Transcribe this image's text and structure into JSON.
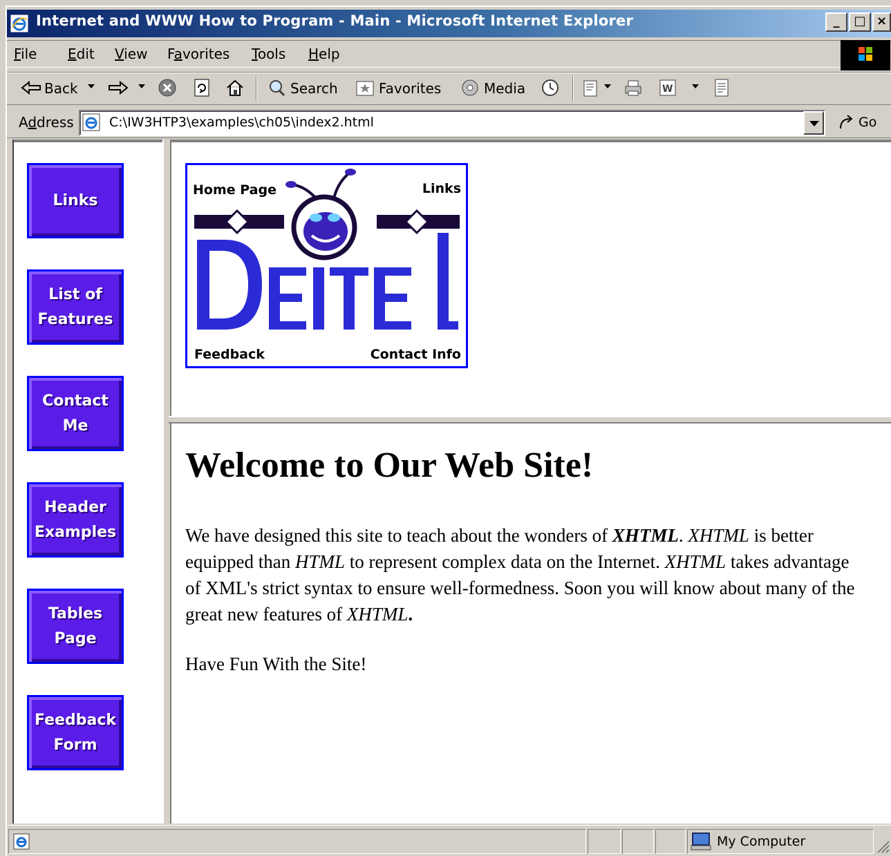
{
  "window": {
    "title": "Internet and WWW How to Program - Main - Microsoft Internet Explorer",
    "min_label": "_",
    "max_label": "□",
    "close_label": "×"
  },
  "menu": {
    "file": {
      "accel": "F",
      "rest": "ile"
    },
    "edit": {
      "accel": "E",
      "rest": "dit"
    },
    "view": {
      "accel": "V",
      "rest": "iew"
    },
    "favorites": {
      "pre": "F",
      "accel": "a",
      "rest": "vorites"
    },
    "tools": {
      "accel": "T",
      "rest": "ools"
    },
    "help": {
      "accel": "H",
      "rest": "elp"
    }
  },
  "toolbar": {
    "back": "Back",
    "search": "Search",
    "favorites": "Favorites",
    "media": "Media"
  },
  "address": {
    "label_pre": "A",
    "label_accel": "d",
    "label_rest": "dress",
    "value": "C:\\IW3HTP3\\examples\\ch05\\index2.html",
    "go": "Go"
  },
  "nav": [
    {
      "label": "Links"
    },
    {
      "label": "List of Features"
    },
    {
      "label": "Contact Me"
    },
    {
      "label": "Header Examples"
    },
    {
      "label": "Tables Page"
    },
    {
      "label": "Feedback Form"
    }
  ],
  "logo": {
    "home": "Home Page",
    "links": "Links",
    "brand": "DEITEL",
    "feedback": "Feedback",
    "contact": "Contact Info"
  },
  "main": {
    "heading": "Welcome to Our Web Site!",
    "p1_a": "We have designed this site to teach about the wonders of ",
    "p1_b": "XHTML",
    "p1_c": ". ",
    "p1_d": "XHTML",
    "p1_e": " is better equipped than ",
    "p1_f": "HTML",
    "p1_g": " to represent complex data on the Internet. ",
    "p1_h": "XHTML",
    "p1_i": " takes advantage of XML's strict syntax to ensure well-formedness. Soon you will know about many of the great new features of ",
    "p1_j": "XHTML",
    "p1_k": ".",
    "p2": "Have Fun With the Site!"
  },
  "status": {
    "zone": "My Computer"
  },
  "colors": {
    "nav_button": "#5a1de8",
    "nav_border": "#0000ff",
    "logo_blue": "#2b2bd6"
  }
}
